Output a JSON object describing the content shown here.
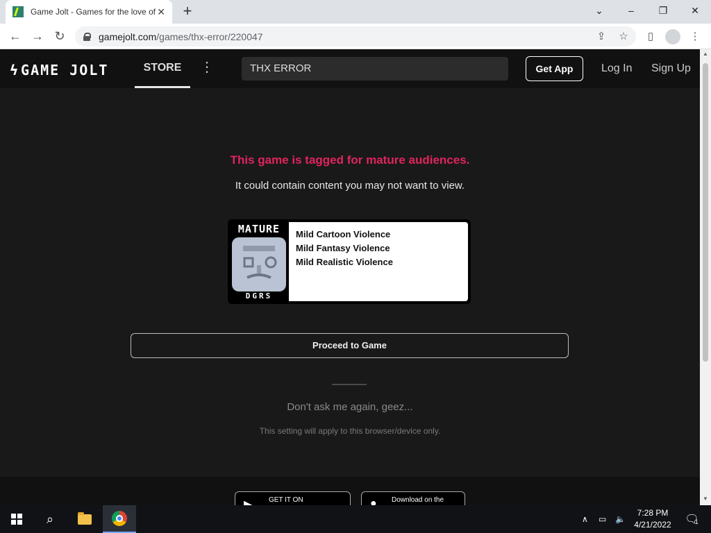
{
  "browser": {
    "tab_title": "Game Jolt - Games for the love of",
    "tab_close": "✕",
    "new_tab": "+",
    "url_domain": "gamejolt.com",
    "url_path": "/games/thx-error/220047",
    "minimize": "–",
    "maximize": "❐",
    "close": "✕"
  },
  "nav": {
    "logo": "GAME JOLT",
    "store": "STORE",
    "more": "⋮",
    "search_value": "THX ERROR",
    "get_app": "Get App",
    "log_in": "Log In",
    "sign_up": "Sign Up"
  },
  "main": {
    "title": "This game is tagged for mature audiences.",
    "subtitle": "It could contain content you may not want to view.",
    "rating_badge_top": "MATURE",
    "rating_badge_bottom": "DGRS",
    "descriptors": [
      "Mild Cartoon Violence",
      "Mild Fantasy Violence",
      "Mild Realistic Violence"
    ],
    "proceed": "Proceed to Game",
    "dont_ask": "Don't ask me again, geez...",
    "setting_note": "This setting will apply to this browser/device only."
  },
  "footer": {
    "google_play": "GET IT ON",
    "app_store": "Download on the"
  },
  "taskbar": {
    "time": "7:28 PM",
    "date": "4/21/2022",
    "notifications": "1"
  },
  "colors": {
    "accent_mature": "#e0245e",
    "page_bg": "#191919",
    "nav_bg": "#111111"
  }
}
